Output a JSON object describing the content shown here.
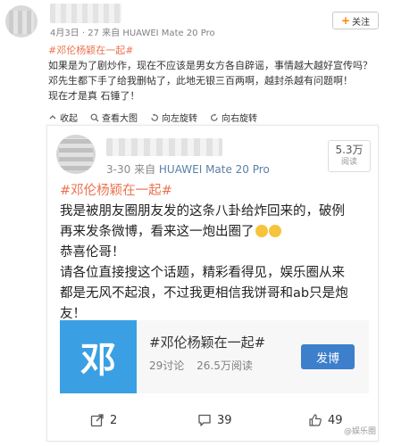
{
  "outer": {
    "meta": "4月3日 · 27 来自 HUAWEI Mate 20 Pro",
    "follow_label": "关注",
    "follow_plus": "+",
    "topic": "#邓伦杨颖在一起#",
    "lines": [
      "如果是为了剧炒作，现在不应该是男女方各自辟谣，事情越大越好宣传吗？",
      "邓先生都下手了给我删帖了，此地无银三百两啊，越封杀越有问题啊！",
      "现在才是真 石锤了！"
    ],
    "actions": [
      {
        "label": "收起",
        "icon": "collapse-icon"
      },
      {
        "label": "查看大图",
        "icon": "zoom-icon"
      },
      {
        "label": "向左旋转",
        "icon": "rotate-left-icon"
      },
      {
        "label": "向右旋转",
        "icon": "rotate-right-icon"
      }
    ]
  },
  "card": {
    "time": "3-30",
    "source_prefix": "来自",
    "device": "HUAWEI Mate 20 Pro",
    "read_count": "5.3万",
    "read_label": "阅读",
    "topic": "#邓伦杨颖在一起#",
    "lines": [
      "我是被朋友圈朋友发的这条八卦给炸回来的，破例",
      "再来发条微博，看来这一炮出圈了",
      "恭喜伦哥！",
      "请各位直接搜这个话题，精彩看得见，娱乐圈从来",
      "都是无风不起浪，不过我更相信我饼哥和ab只是炮",
      "友！"
    ],
    "topic_card": {
      "logo_char": "邓",
      "title": "#邓伦杨颖在一起#",
      "discussions": "29讨论",
      "reads": "26.5万阅读",
      "post_label": "发博"
    },
    "actions": {
      "share_count": "2",
      "comment_count": "39",
      "like_count": "49"
    },
    "watermark": "@娱乐圈"
  },
  "colors": {
    "topic": "#eb7350",
    "accent_orange": "#ff8200",
    "topic_logo_bg": "#3aa0e3",
    "post_button": "#3d7fcb"
  }
}
